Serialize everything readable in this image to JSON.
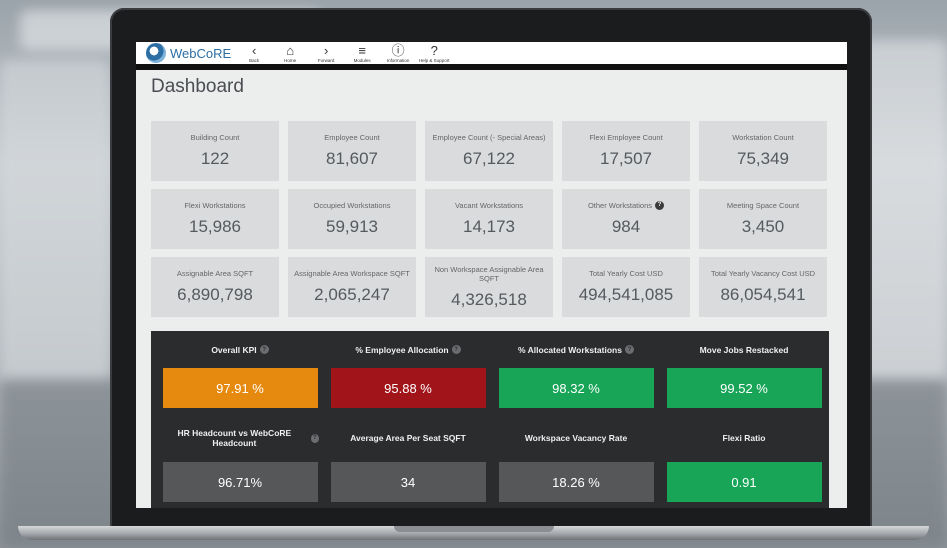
{
  "colors": {
    "orange": "#e58a0f",
    "red": "#a0141a",
    "green": "#18a558",
    "gray": "#555759",
    "accent": "#2d6ea3"
  },
  "app": {
    "name": "WebCoRE",
    "icon": "webcore-logo-icon"
  },
  "nav": [
    {
      "glyph": "‹",
      "label": "Back",
      "icon": "back-arrow-icon"
    },
    {
      "glyph": "⌂",
      "label": "Home",
      "icon": "home-icon"
    },
    {
      "glyph": "›",
      "label": "Forward",
      "icon": "forward-arrow-icon"
    },
    {
      "glyph": "≡",
      "label": "Modules",
      "icon": "menu-icon"
    },
    {
      "glyph": "ⓘ",
      "label": "Information",
      "icon": "info-icon"
    },
    {
      "glyph": "?",
      "label": "Help & Support",
      "icon": "help-icon"
    }
  ],
  "page_title": "Dashboard",
  "cards": [
    {
      "label": "Building Count",
      "value": "122"
    },
    {
      "label": "Employee Count",
      "value": "81,607"
    },
    {
      "label": "Employee Count (- Special Areas)",
      "value": "67,122"
    },
    {
      "label": "Flexi Employee Count",
      "value": "17,507"
    },
    {
      "label": "Workstation Count",
      "value": "75,349"
    },
    {
      "label": "Flexi Workstations",
      "value": "15,986"
    },
    {
      "label": "Occupied Workstations",
      "value": "59,913"
    },
    {
      "label": "Vacant Workstations",
      "value": "14,173"
    },
    {
      "label": "Other Workstations",
      "value": "984",
      "info": true
    },
    {
      "label": "Meeting Space Count",
      "value": "3,450"
    },
    {
      "label": "Assignable Area SQFT",
      "value": "6,890,798"
    },
    {
      "label": "Assignable Area Workspace SQFT",
      "value": "2,065,247"
    },
    {
      "label": "Non Workspace Assignable Area SQFT",
      "value": "4,326,518"
    },
    {
      "label": "Total Yearly Cost USD",
      "value": "494,541,085"
    },
    {
      "label": "Total Yearly Vacancy Cost USD",
      "value": "86,054,541"
    }
  ],
  "kpis": [
    {
      "label": "Overall KPI",
      "value": "97.91 %",
      "color": "orange",
      "info": true
    },
    {
      "label": "% Employee Allocation",
      "value": "95.88 %",
      "color": "red",
      "info": true
    },
    {
      "label": "% Allocated Workstations",
      "value": "98.32 %",
      "color": "green",
      "info": true
    },
    {
      "label": "Move Jobs Restacked",
      "value": "99.52 %",
      "color": "green",
      "info": false
    },
    {
      "label": "HR Headcount vs WebCoRE Headcount",
      "value": "96.71%",
      "color": "gray",
      "info": true
    },
    {
      "label": "Average Area Per Seat SQFT",
      "value": "34",
      "color": "gray",
      "info": false
    },
    {
      "label": "Workspace Vacancy Rate",
      "value": "18.26 %",
      "color": "gray",
      "info": false
    },
    {
      "label": "Flexi Ratio",
      "value": "0.91",
      "color": "green",
      "info": false
    }
  ]
}
